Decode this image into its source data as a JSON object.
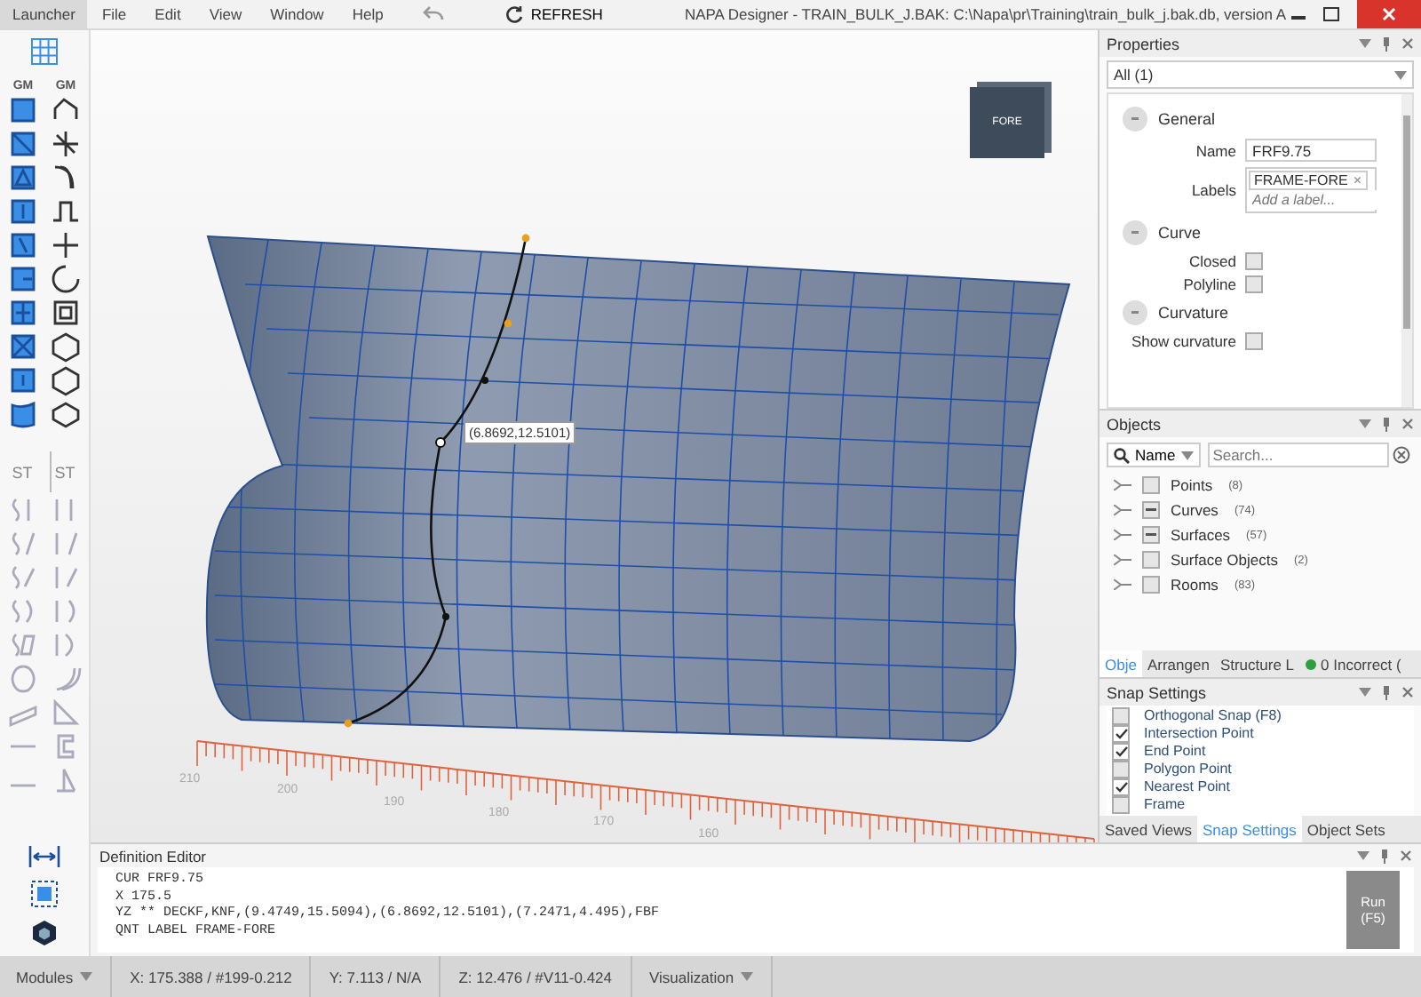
{
  "menu_bar": {
    "launcher": "Launcher",
    "items": [
      "File",
      "Edit",
      "View",
      "Window",
      "Help"
    ],
    "refresh": "REFRESH",
    "title": "NAPA Designer - TRAIN_BULK_J.BAK: C:\\Napa\\pr\\Training\\train_bulk_j.bak.db, version A"
  },
  "toolbar": {
    "groups": [
      {
        "kind": "geometry",
        "labels": [
          "GM",
          "GM"
        ]
      },
      {
        "kind": "structure",
        "labels": [
          "ST",
          "ST"
        ]
      }
    ]
  },
  "viewport": {
    "view_cube": "FORE",
    "coordinate_label": "(6.8692,12.5101)",
    "ruler_labels": [
      "210",
      "200",
      "190",
      "180",
      "170",
      "160"
    ]
  },
  "properties": {
    "title": "Properties",
    "filter": "All (1)",
    "sections": [
      {
        "title": "General",
        "fields": [
          {
            "kind": "text",
            "label": "Name",
            "value": "FRF9.75"
          },
          {
            "kind": "labels",
            "label": "Labels",
            "chips": [
              "FRAME-FORE"
            ],
            "chip_close": "×",
            "placeholder": "Add a label..."
          }
        ]
      },
      {
        "title": "Curve",
        "fields": [
          {
            "kind": "check",
            "label": "Closed",
            "checked": false
          },
          {
            "kind": "check",
            "label": "Polyline",
            "checked": false
          }
        ]
      },
      {
        "title": "Curvature",
        "fields": [
          {
            "kind": "check",
            "label": "Show curvature",
            "checked": false
          }
        ]
      }
    ]
  },
  "objects": {
    "title": "Objects",
    "search_mode": "Name",
    "placeholder": "Search...",
    "items": [
      {
        "label": "Points",
        "count": "(8)",
        "partial": false
      },
      {
        "label": "Curves",
        "count": "(74)",
        "partial": true
      },
      {
        "label": "Surfaces",
        "count": "(57)",
        "partial": true
      },
      {
        "label": "Surface Objects",
        "count": "(2)",
        "partial": false
      },
      {
        "label": "Rooms",
        "count": "(83)",
        "partial": false
      }
    ],
    "tabs": [
      {
        "label": "Obje",
        "selected": true
      },
      {
        "label": "Arrangen",
        "selected": false
      },
      {
        "label": "Structure L",
        "selected": false
      },
      {
        "label": "0 Incorrect (",
        "selected": false,
        "color": "#2e9e3e"
      }
    ]
  },
  "snap_settings": {
    "title": "Snap Settings",
    "items": [
      {
        "label": "Orthogonal Snap (F8)",
        "checked": false
      },
      {
        "label": "Intersection Point",
        "checked": true
      },
      {
        "label": "End Point",
        "checked": true
      },
      {
        "label": "Polygon Point",
        "checked": false
      },
      {
        "label": "Nearest Point",
        "checked": true
      },
      {
        "label": "Frame",
        "checked": false
      }
    ],
    "tabs": [
      {
        "label": "Saved Views",
        "selected": false
      },
      {
        "label": "Snap Settings",
        "selected": true
      },
      {
        "label": "Object Sets",
        "selected": false
      }
    ]
  },
  "definition_editor": {
    "title": "Definition Editor",
    "lines": [
      "CUR FRF9.75",
      "X 175.5",
      "YZ ** DECKF,KNF,(9.4749,15.5094),(6.8692,12.5101),(7.2471,4.495),FBF",
      "QNT LABEL FRAME-FORE"
    ],
    "run_button": "Run (F5)"
  },
  "status_bar": [
    {
      "kind": "menu",
      "text": "Modules"
    },
    {
      "kind": "readout",
      "text": "X: 175.388 / #199-0.212"
    },
    {
      "kind": "readout",
      "text": "Y: 7.113 / N/A"
    },
    {
      "kind": "readout",
      "text": "Z: 12.476 / #V11-0.424"
    },
    {
      "kind": "menu",
      "text": "Visualization"
    }
  ]
}
